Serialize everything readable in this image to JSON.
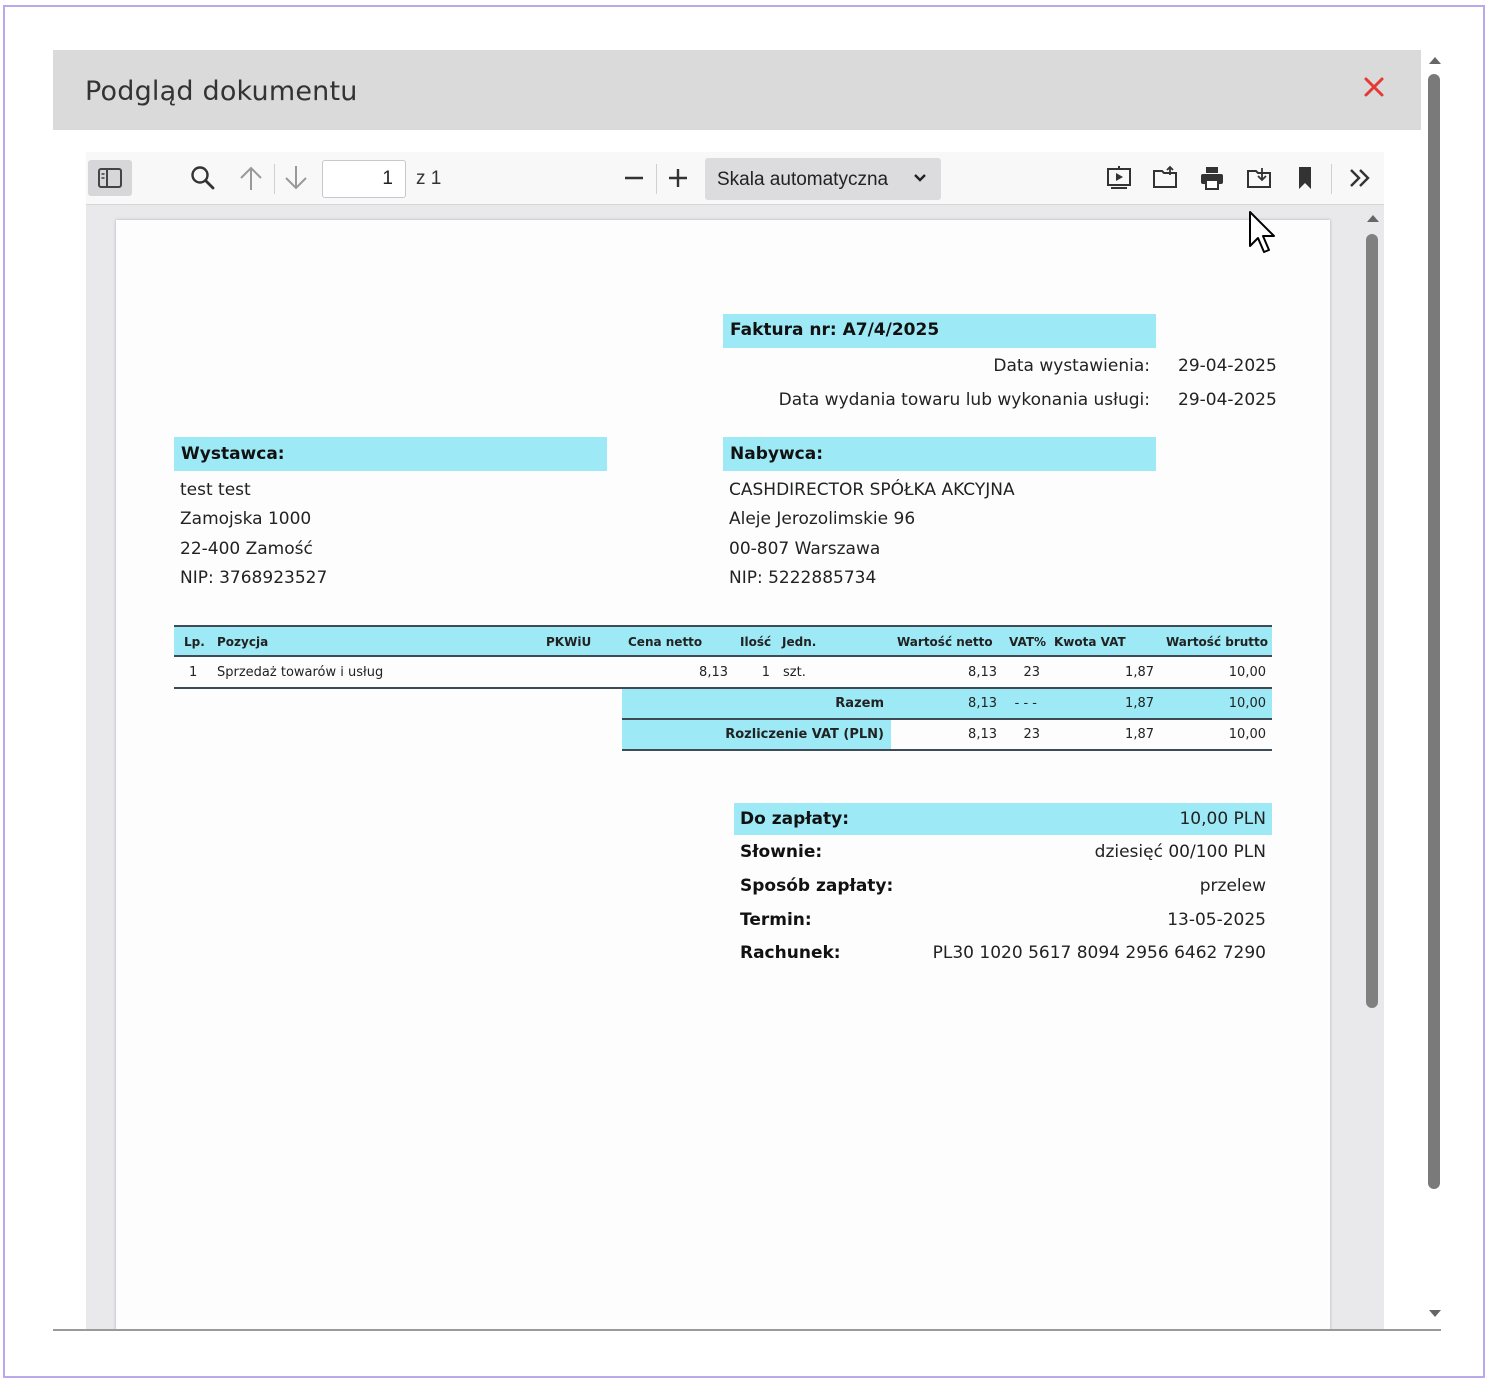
{
  "dialog": {
    "title": "Podgląd dokumentu"
  },
  "toolbar": {
    "page_number": "1",
    "page_of": "z 1",
    "scale": "Skala automatyczna"
  },
  "invoice": {
    "title": "Faktura nr: A7/4/2025",
    "issue_date_label": "Data wystawienia:",
    "issue_date": "29-04-2025",
    "delivery_date_label": "Data wydania towaru lub wykonania usługi:",
    "delivery_date": "29-04-2025",
    "seller": {
      "heading": "Wystawca:",
      "lines": [
        "test test",
        "Zamojska 1000",
        "22-400 Zamość",
        "NIP: 3768923527"
      ]
    },
    "buyer": {
      "heading": "Nabywca:",
      "lines": [
        "CASHDIRECTOR SPÓŁKA AKCYJNA",
        "Aleje Jerozolimskie 96",
        "00-807 Warszawa",
        "NIP: 5222885734"
      ]
    },
    "table": {
      "headers": [
        "Lp.",
        "Pozycja",
        "PKWiU",
        "Cena netto",
        "Ilość",
        "Jedn.",
        "Wartość netto",
        "VAT%",
        "Kwota VAT",
        "Wartość brutto"
      ],
      "rows": [
        {
          "lp": "1",
          "name": "Sprzedaż towarów i usług",
          "pkwiu": "",
          "price": "8,13",
          "qty": "1",
          "unit": "szt.",
          "net": "8,13",
          "vat_rate": "23",
          "vat": "1,87",
          "gross": "10,00"
        }
      ],
      "total": {
        "label": "Razem",
        "net": "8,13",
        "vat_rate": "- - -",
        "vat": "1,87",
        "gross": "10,00"
      },
      "vat_summary": {
        "label": "Rozliczenie VAT (PLN)",
        "net": "8,13",
        "vat_rate": "23",
        "vat": "1,87",
        "gross": "10,00"
      }
    },
    "payment": {
      "due_label": "Do zapłaty:",
      "due": "10,00 PLN",
      "words_label": "Słownie:",
      "words": "dziesięć 00/100 PLN",
      "method_label": "Sposób zapłaty:",
      "method": "przelew",
      "term_label": "Termin:",
      "term": "13-05-2025",
      "account_label": "Rachunek:",
      "account": "PL30 1020 5617 8094 2956 6462 7290"
    }
  },
  "colors": {
    "highlight": "#9deaf6",
    "close": "#e53935",
    "frame": "#b9a9ea"
  }
}
